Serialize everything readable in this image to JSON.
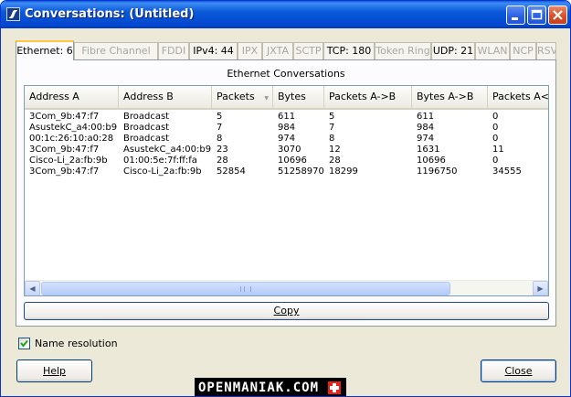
{
  "window": {
    "title": "Conversations: (Untitled)"
  },
  "tabs": [
    {
      "label": "Ethernet: 6",
      "active": true,
      "enabled": true
    },
    {
      "label": "Fibre Channel",
      "active": false,
      "enabled": false
    },
    {
      "label": "FDDI",
      "active": false,
      "enabled": false
    },
    {
      "label": "IPv4: 44",
      "active": false,
      "enabled": true
    },
    {
      "label": "IPX",
      "active": false,
      "enabled": false
    },
    {
      "label": "JXTA",
      "active": false,
      "enabled": false
    },
    {
      "label": "SCTP",
      "active": false,
      "enabled": false
    },
    {
      "label": "TCP: 180",
      "active": false,
      "enabled": true
    },
    {
      "label": "Token Ring",
      "active": false,
      "enabled": false
    },
    {
      "label": "UDP: 21",
      "active": false,
      "enabled": true
    },
    {
      "label": "WLAN",
      "active": false,
      "enabled": false
    },
    {
      "label": "NCP",
      "active": false,
      "enabled": false
    },
    {
      "label": "RSVP",
      "active": false,
      "enabled": false
    }
  ],
  "panel": {
    "title": "Ethernet Conversations"
  },
  "table": {
    "columns": [
      "Address A",
      "Address B",
      "Packets",
      "Bytes",
      "Packets A->B",
      "Bytes A->B",
      "Packets A<-B"
    ],
    "rows": [
      [
        "3Com_9b:47:f7",
        "Broadcast",
        "5",
        "611",
        "5",
        "611",
        "0"
      ],
      [
        "AsustekC_a4:00:b9",
        "Broadcast",
        "7",
        "984",
        "7",
        "984",
        "0"
      ],
      [
        "00:1c:26:10:a0:28",
        "Broadcast",
        "8",
        "974",
        "8",
        "974",
        "0"
      ],
      [
        "3Com_9b:47:f7",
        "AsustekC_a4:00:b9",
        "23",
        "3070",
        "12",
        "1631",
        "11"
      ],
      [
        "Cisco-Li_2a:fb:9b",
        "01:00:5e:7f:ff:fa",
        "28",
        "10696",
        "28",
        "10696",
        "0"
      ],
      [
        "3Com_9b:47:f7",
        "Cisco-Li_2a:fb:9b",
        "52854",
        "51258970",
        "18299",
        "1196750",
        "34555"
      ]
    ]
  },
  "buttons": {
    "copy": "Copy",
    "help": "Help",
    "close": "Close"
  },
  "options": {
    "name_resolution_label": "Name resolution",
    "name_resolution_checked": true
  },
  "watermark": {
    "text": "OPENMANIAK.COM"
  },
  "icons": {
    "app": "wireshark-fin-icon",
    "minimize": "minimize-icon",
    "maximize": "maximize-icon",
    "close": "close-icon",
    "sort": "sort-descending-icon",
    "scroll_left": "arrow-left-icon",
    "scroll_right": "arrow-right-icon",
    "check": "checkmark-icon",
    "flag": "swiss-flag-icon"
  },
  "colors": {
    "titlebar": "#0a58d8",
    "tab_highlight": "#ffc83c",
    "window_bg": "#ece9d8"
  }
}
